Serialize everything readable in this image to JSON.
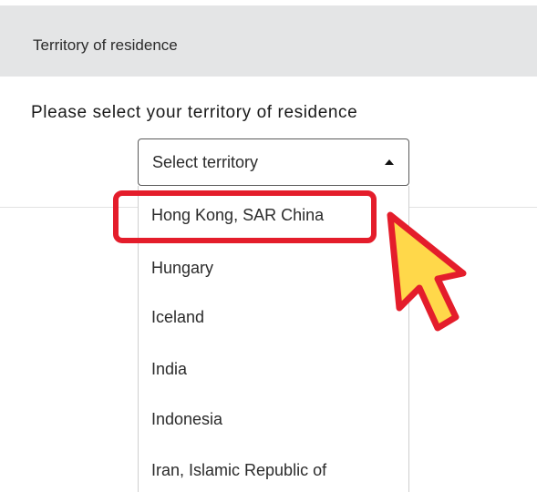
{
  "header": {
    "title": "Territory of residence"
  },
  "prompt": {
    "text": "Please select your territory of residence"
  },
  "select": {
    "placeholder": "Select territory"
  },
  "dropdown": {
    "options": [
      "Hong Kong, SAR China",
      "Hungary",
      "Iceland",
      "India",
      "Indonesia",
      "Iran, Islamic Republic of"
    ],
    "highlighted_option": "Hong Kong, SAR China"
  },
  "annotation": {
    "highlight_color": "#e41d2b",
    "cursor_fill": "#ffd84a",
    "cursor_outline": "#e41d2b",
    "cursor_icon": "pointer-arrow-icon"
  },
  "colors": {
    "header_bg": "#e4e5e6"
  }
}
